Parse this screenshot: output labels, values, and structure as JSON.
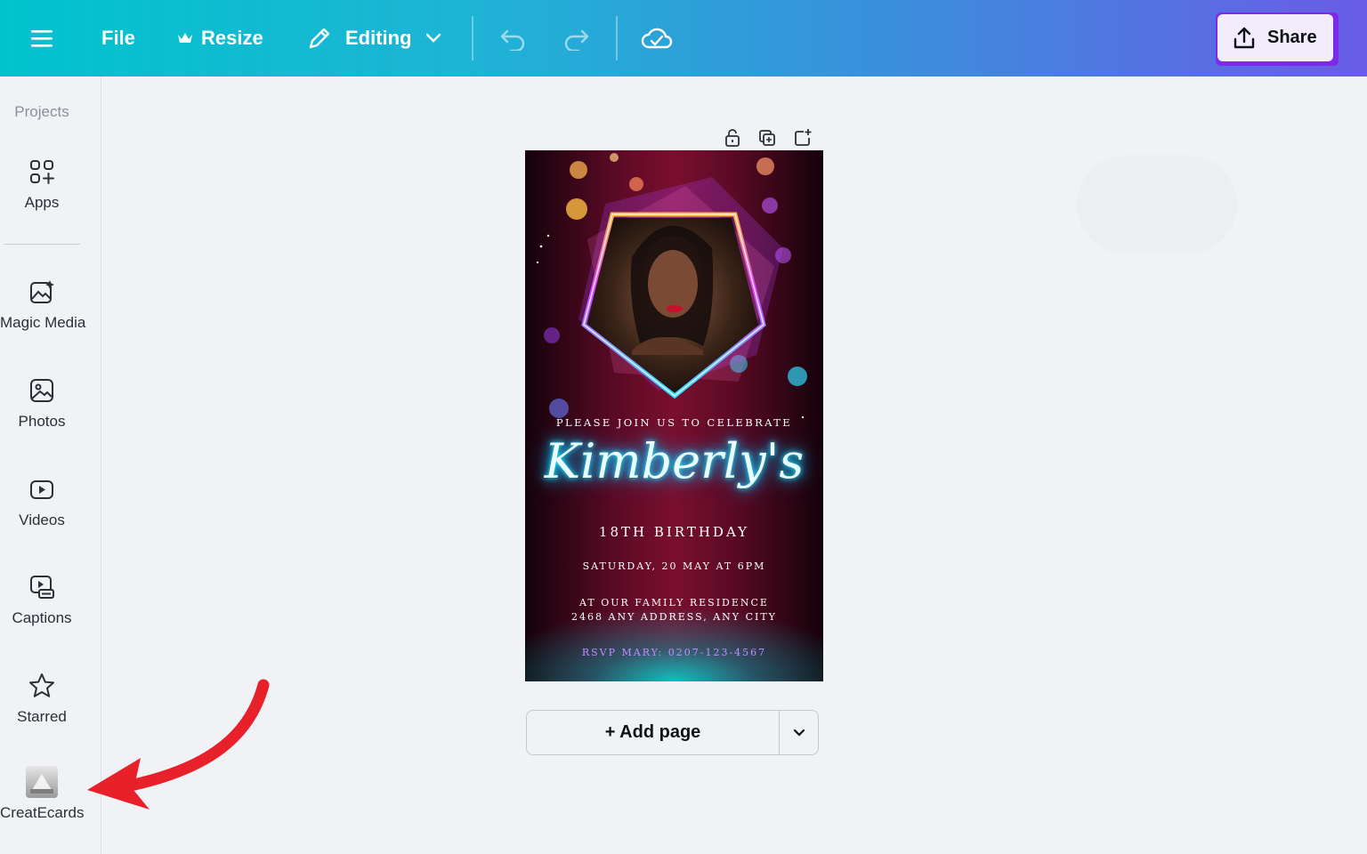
{
  "topbar": {
    "file_label": "File",
    "resize_label": "Resize",
    "editing_label": "Editing",
    "share_label": "Share",
    "icons": [
      "menu-icon",
      "crown-icon",
      "pencil-icon",
      "chevron-down-icon",
      "undo-icon",
      "redo-icon",
      "cloud-check-icon",
      "share-upload-icon"
    ]
  },
  "sidebar": {
    "projects_label": "Projects",
    "items": [
      {
        "label": "Apps",
        "icon": "apps-grid-icon"
      },
      {
        "label": "Magic Media",
        "icon": "magic-media-icon"
      },
      {
        "label": "Photos",
        "icon": "photo-icon"
      },
      {
        "label": "Videos",
        "icon": "video-play-icon"
      },
      {
        "label": "Captions",
        "icon": "captions-icon"
      },
      {
        "label": "Starred",
        "icon": "star-icon"
      },
      {
        "label": "CreatEcards",
        "icon": "createcards-app-icon"
      }
    ]
  },
  "page_tools": [
    "lock-icon",
    "duplicate-page-icon",
    "add-page-icon"
  ],
  "design": {
    "join_text": "PLEASE JOIN US TO CELEBRATE",
    "name_text": "Kimberly's",
    "birthday_text": "18TH BIRTHDAY",
    "date_text": "SATURDAY, 20 MAY AT 6PM",
    "residence_text": "AT OUR FAMILY RESIDENCE",
    "address_text": "2468 ANY ADDRESS, ANY CITY",
    "rsvp_text": "RSVP MARY: 0207-123-4567"
  },
  "add_page_label": "+ Add page",
  "colors": {
    "accent_purple": "#7d2ae8",
    "topbar_start": "#00c4cc",
    "topbar_end": "#6a5ce6",
    "annotation_arrow": "#e8202a"
  }
}
